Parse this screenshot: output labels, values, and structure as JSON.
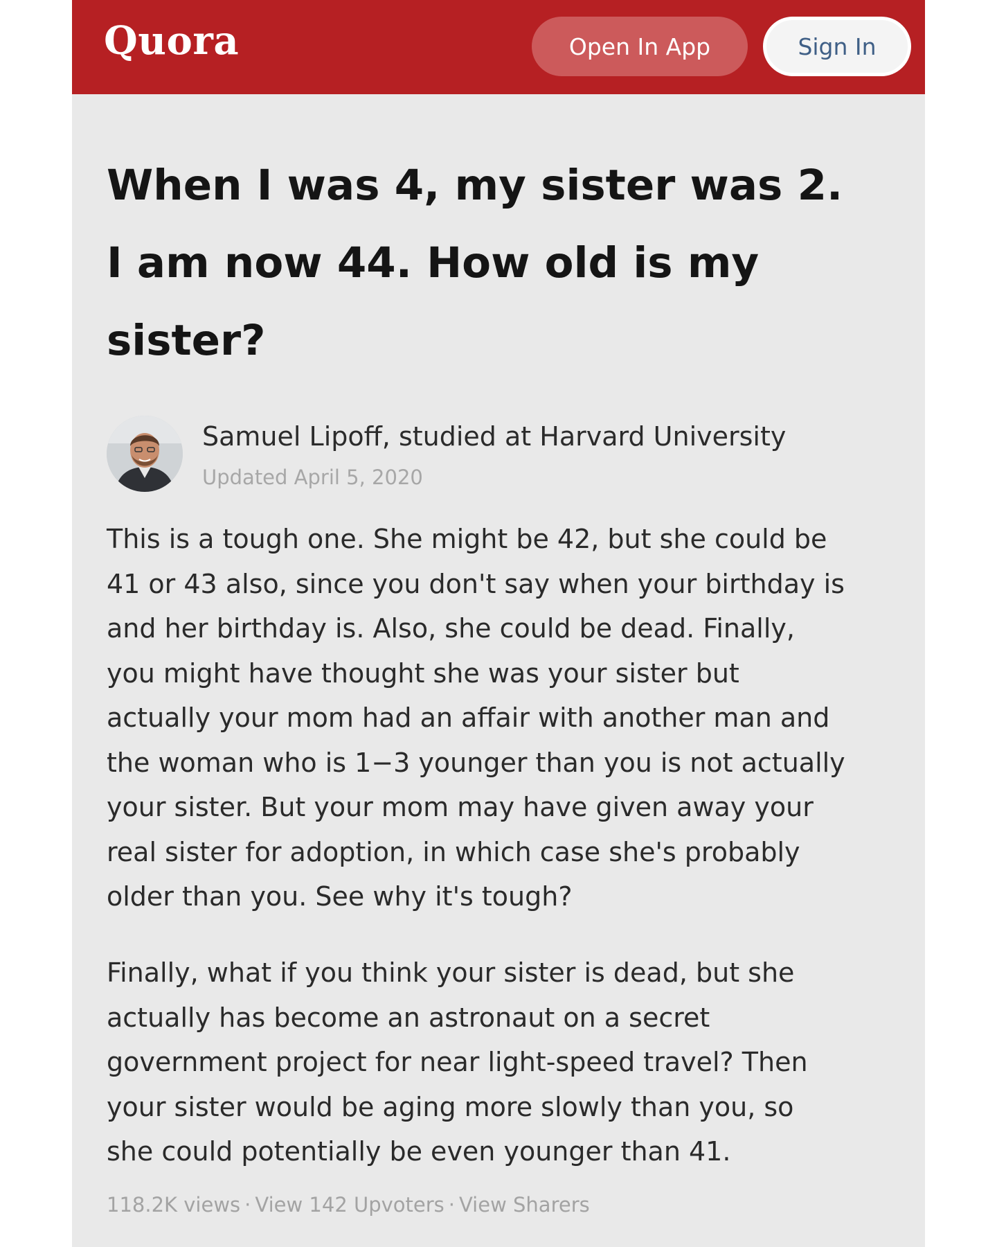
{
  "header": {
    "logo": "Quora",
    "open_in_app_label": "Open In App",
    "sign_in_label": "Sign In",
    "brand_color": "#b62023"
  },
  "question": {
    "title_lines": [
      "When I was 4, my sister was 2.",
      "I am now 44. How old is my",
      "sister?"
    ]
  },
  "answer": {
    "author": "Samuel Lipoff, studied at Harvard University",
    "date": "Updated April 5, 2020",
    "avatar_icon": "user-photo",
    "paragraph1_lines": [
      "This is a tough one. She might be 42, but she could be",
      "41 or 43 also, since you don't say when your birthday is",
      "and her birthday is. Also, she could be dead. Finally,",
      "you might have thought she was your sister but",
      "actually your mom had an affair with another man and",
      "the woman who is 1−3 younger than you is not actually",
      "your sister. But your mom may have given away your",
      "real sister for adoption, in which case she's probably",
      "older than you. See why it's tough?"
    ],
    "paragraph2_lines": [
      "Finally, what if you think your sister is dead, but she",
      "actually has become an astronaut on a secret",
      "government project for near light-speed travel? Then",
      "your sister would be aging more slowly than you, so",
      "she could potentially be even younger than 41."
    ]
  },
  "footer": {
    "views": "118.2K views",
    "separator": "·",
    "upvoters": "View 142 Upvoters",
    "sharers": "View Sharers"
  }
}
